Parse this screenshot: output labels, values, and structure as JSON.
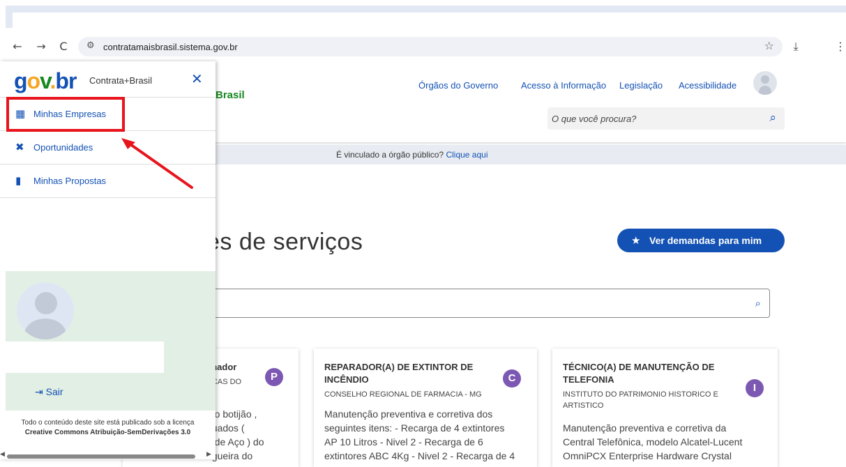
{
  "browser": {
    "url": "contratamaisbrasil.sistema.gov.br",
    "back_icon": "←",
    "forward_icon": "→",
    "reload_icon": "C",
    "download_icon": "⤓",
    "more_icon": "⋮"
  },
  "site": {
    "logo_partial": "Brasil",
    "nav_links": [
      "Órgãos do Governo",
      "Acesso à Informação",
      "Legislação",
      "Acessibilidade"
    ],
    "search_placeholder": "O que você procura?",
    "banner_text": "É vinculado a órgão público?",
    "banner_link": "Clique aqui",
    "heading_partial": "es de serviços",
    "ver_demandas_label": "Ver demandas para mim"
  },
  "cards": [
    {
      "title_lines": [
        "anador",
        ""
      ],
      "org_lines": [
        "UCAS DO",
        ""
      ],
      "badge": "P",
      "desc_lines": [
        "o o botijão ,",
        "guados (",
        "a de Aço ) do",
        "ngueira do"
      ]
    },
    {
      "title_lines": [
        "REPARADOR(A) DE EXTINTOR DE",
        "INCÊNDIO"
      ],
      "org_lines": [
        "CONSELHO REGIONAL DE FARMACIA - MG"
      ],
      "badge": "C",
      "desc_lines": [
        "Manutenção preventiva e corretiva dos",
        "seguintes itens: - Recarga de 4 extintores",
        "AP 10 Litros - Nivel 2 - Recarga de 6",
        "extintores ABC 4Kg - Nivel 2 - Recarga de 4"
      ]
    },
    {
      "title_lines": [
        "TÉCNICO(A) DE MANUTENÇÃO DE",
        "TELEFONIA"
      ],
      "org_lines": [
        "INSTITUTO DO PATRIMONIO HISTORICO E",
        "ARTISTICO"
      ],
      "badge": "I",
      "desc_lines": [
        "Manutenção preventiva e corretiva da",
        "Central Telefônica, modelo Alcatel-Lucent",
        "OmniPCX Enterprise Hardware Crystal",
        ""
      ]
    }
  ],
  "sidemenu": {
    "logo_text": "gov.br",
    "logo_subtitle": "Contrata+Brasil",
    "items": [
      {
        "label": "Minhas Empresas",
        "icon": "building-icon"
      },
      {
        "label": "Oportunidades",
        "icon": "tools-icon"
      },
      {
        "label": "Minhas Propostas",
        "icon": "briefcase-icon"
      }
    ],
    "logout_label": "Sair",
    "footer_line1": "Todo o conteúdo deste site está publicado sob a licença",
    "footer_line2": "Creative Commons Atribuição-SemDerivações 3.0"
  },
  "colors": {
    "primary": "#1351b4",
    "highlight": "#e8141c",
    "badge": "#7c58b3",
    "profile_bg": "#e2efe4"
  }
}
